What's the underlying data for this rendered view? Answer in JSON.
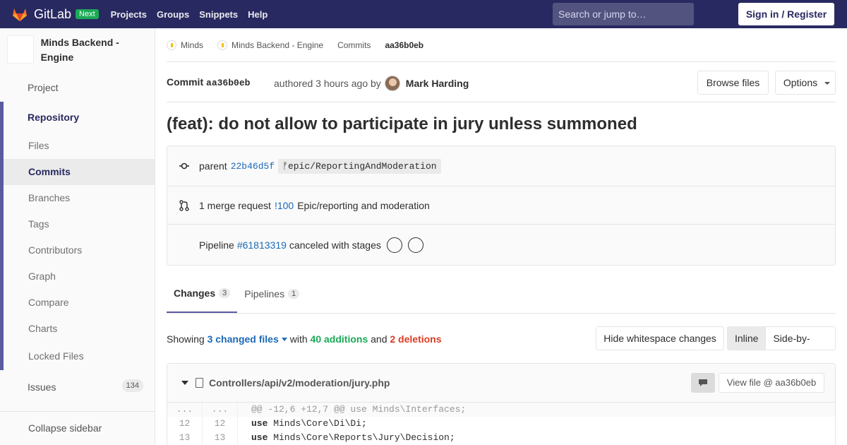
{
  "nav": {
    "brand": "GitLab",
    "badge": "Next",
    "links": [
      "Projects",
      "Groups",
      "Snippets",
      "Help"
    ],
    "search_placeholder": "Search or jump to…",
    "signin": "Sign in / Register"
  },
  "sidebar": {
    "project_name": "Minds Backend - Engine",
    "project": "Project",
    "repository": "Repository",
    "repo_items": [
      "Files",
      "Commits",
      "Branches",
      "Tags",
      "Contributors",
      "Graph",
      "Compare",
      "Charts",
      "Locked Files"
    ],
    "issues": "Issues",
    "issues_count": "134",
    "collapse": "Collapse sidebar"
  },
  "breadcrumbs": [
    "Minds",
    "Minds Backend - Engine",
    "Commits",
    "aa36b0eb"
  ],
  "commit": {
    "label": "Commit",
    "sha": "aa36b0eb",
    "authored": "authored 3 hours ago by",
    "author": "Mark Harding",
    "browse": "Browse files",
    "options": "Options",
    "title": "(feat): do not allow to participate in jury unless summoned"
  },
  "info": {
    "parent_label": "parent",
    "parent_sha": "22b46d5f",
    "branch": "epic/ReportingAndModeration",
    "mr_text": "1 merge request",
    "mr_link": "!100",
    "mr_title": "Epic/reporting and moderation",
    "pipeline_label": "Pipeline",
    "pipeline_link": "#61813319",
    "pipeline_status": "canceled with stages"
  },
  "tabs": [
    {
      "label": "Changes",
      "count": "3"
    },
    {
      "label": "Pipelines",
      "count": "1"
    }
  ],
  "summary": {
    "showing": "Showing",
    "files": "3 changed files",
    "with": "with",
    "additions": "40 additions",
    "and": "and",
    "deletions": "2 deletions",
    "hide_ws": "Hide whitespace changes",
    "inline": "Inline",
    "side": "Side-by-side"
  },
  "diff": {
    "path": "Controllers/api/v2/moderation/jury.php",
    "view_file": "View file @ aa36b0eb",
    "lines": [
      {
        "old": "...",
        "new": "...",
        "code": "@@ -12,6 +12,7 @@ use Minds\\Interfaces;",
        "type": "match"
      },
      {
        "old": "12",
        "new": "12",
        "kw": "use",
        "code": " Minds\\Core\\Di\\Di;",
        "type": "normal"
      },
      {
        "old": "13",
        "new": "13",
        "kw": "use",
        "code": " Minds\\Core\\Reports\\Jury\\Decision;",
        "type": "normal"
      }
    ]
  },
  "colors": {
    "navbar": "#292961",
    "link": "#1b69b6",
    "additions": "#1aaa55",
    "deletions": "#db3b21"
  }
}
